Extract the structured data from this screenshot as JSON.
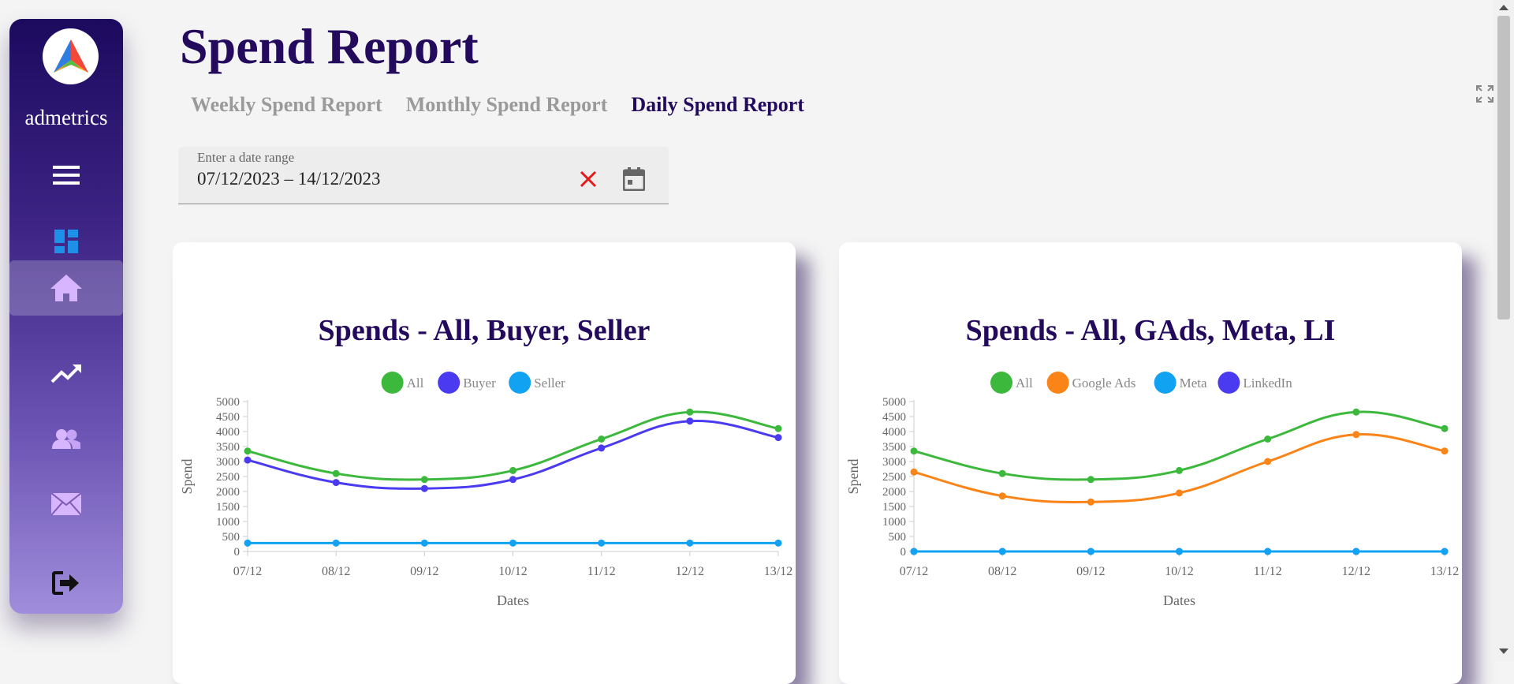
{
  "brand": {
    "name": "admetrics"
  },
  "sidebar": {
    "items": [
      {
        "icon": "menu-icon"
      },
      {
        "icon": "dashboard-icon"
      },
      {
        "icon": "home-icon",
        "active": true
      },
      {
        "icon": "trending-up-icon"
      },
      {
        "icon": "users-icon"
      },
      {
        "icon": "mail-icon"
      },
      {
        "icon": "logout-icon"
      }
    ]
  },
  "page": {
    "title": "Spend Report"
  },
  "tabs": [
    {
      "label": "Weekly Spend Report",
      "active": false
    },
    {
      "label": "Monthly Spend Report",
      "active": false
    },
    {
      "label": "Daily Spend Report",
      "active": true
    }
  ],
  "date_range": {
    "label": "Enter a date range",
    "value": "07/12/2023 – 14/12/2023"
  },
  "colors": {
    "accent": "#230a5c",
    "all": "#3cb83c",
    "buyer": "#4b3bf0",
    "seller": "#12a2f2",
    "google_ads": "#fb8418",
    "meta": "#12a2f2",
    "linkedin": "#4b3bf0",
    "clear": "#e41a1a"
  },
  "chart_data": [
    {
      "type": "line",
      "title": "Spends - All, Buyer, Seller",
      "xlabel": "Dates",
      "ylabel": "Spend",
      "ylim": [
        0,
        5000
      ],
      "yticks": [
        0,
        500,
        1000,
        1500,
        2000,
        2500,
        3000,
        3500,
        4000,
        4500,
        5000
      ],
      "legend": "top",
      "categories": [
        "07/12",
        "08/12",
        "09/12",
        "10/12",
        "11/12",
        "12/12",
        "13/12"
      ],
      "series": [
        {
          "name": "All",
          "color": "#3cb83c",
          "values": [
            3350,
            2600,
            2400,
            2700,
            3750,
            4650,
            4100
          ]
        },
        {
          "name": "Buyer",
          "color": "#4b3bf0",
          "values": [
            3050,
            2300,
            2100,
            2400,
            3450,
            4350,
            3800
          ]
        },
        {
          "name": "Seller",
          "color": "#12a2f2",
          "values": [
            280,
            280,
            280,
            280,
            280,
            280,
            280
          ]
        }
      ]
    },
    {
      "type": "line",
      "title": "Spends - All, GAds, Meta, LI",
      "xlabel": "Dates",
      "ylabel": "Spend",
      "ylim": [
        0,
        5000
      ],
      "yticks": [
        0,
        500,
        1000,
        1500,
        2000,
        2500,
        3000,
        3500,
        4000,
        4500,
        5000
      ],
      "legend": "top",
      "categories": [
        "07/12",
        "08/12",
        "09/12",
        "10/12",
        "11/12",
        "12/12",
        "13/12"
      ],
      "series": [
        {
          "name": "All",
          "color": "#3cb83c",
          "values": [
            3350,
            2600,
            2400,
            2700,
            3750,
            4650,
            4100
          ]
        },
        {
          "name": "Google Ads",
          "color": "#fb8418",
          "values": [
            2650,
            1850,
            1650,
            1950,
            3000,
            3900,
            3350
          ]
        },
        {
          "name": "Meta",
          "color": "#12a2f2",
          "values": [
            0,
            0,
            0,
            0,
            0,
            0,
            0
          ]
        },
        {
          "name": "LinkedIn",
          "color": "#4b3bf0",
          "values": [
            0,
            0,
            0,
            0,
            0,
            0,
            0
          ]
        }
      ]
    }
  ]
}
